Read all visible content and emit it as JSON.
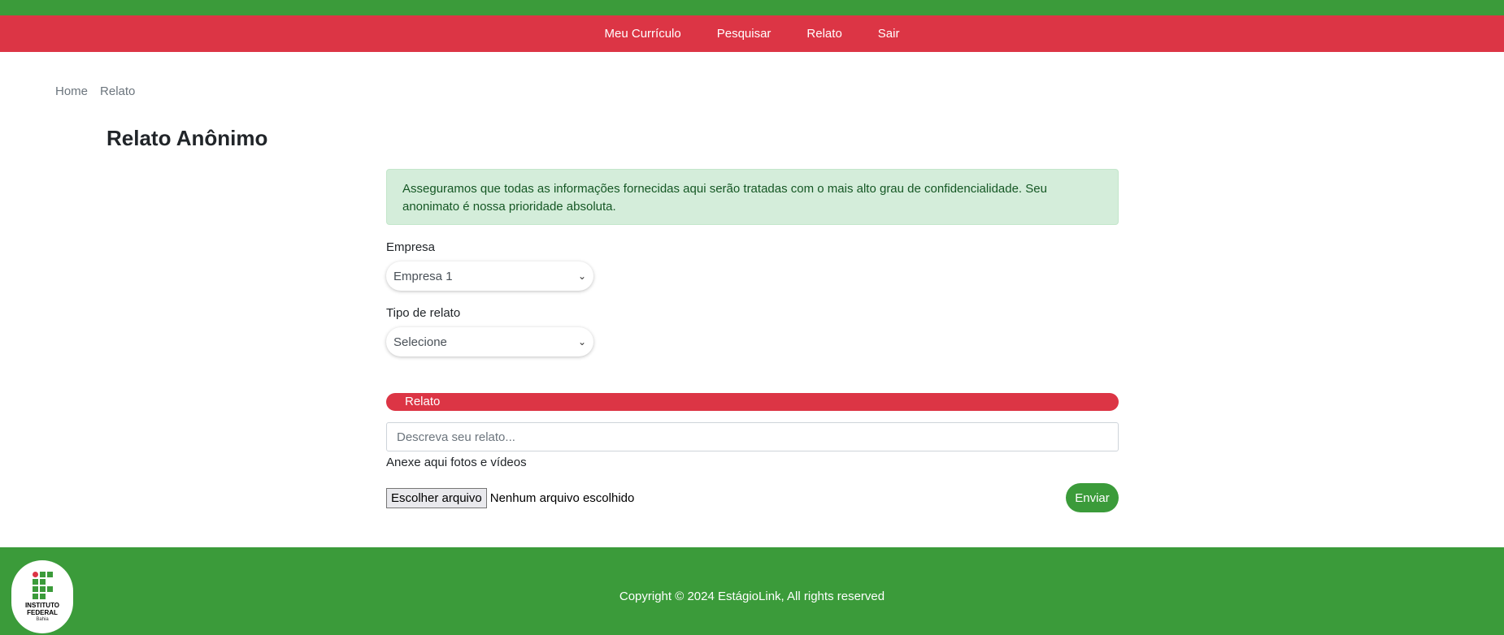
{
  "nav": {
    "items": [
      "Meu Currículo",
      "Pesquisar",
      "Relato",
      "Sair"
    ]
  },
  "breadcrumb": {
    "home": "Home",
    "current": "Relato"
  },
  "page": {
    "title": "Relato Anônimo"
  },
  "alert": {
    "text": "Asseguramos que todas as informações fornecidas aqui serão tratadas com o mais alto grau de confidencialidade. Seu anonimato é nossa prioridade absoluta."
  },
  "form": {
    "empresa_label": "Empresa",
    "empresa_value": "Empresa 1",
    "tipo_label": "Tipo de relato",
    "tipo_value": "Selecione",
    "relato_section": "Relato",
    "relato_placeholder": "Descreva seu relato...",
    "attach_label": "Anexe aqui fotos e vídeos",
    "file_button": "Escolher arquivo",
    "file_status": "Nenhum arquivo escolhido",
    "submit": "Enviar"
  },
  "footer": {
    "copyright": "Copyright © 2024 EstágioLink, All rights reserved",
    "logo_line1": "INSTITUTO",
    "logo_line2": "FEDERAL",
    "logo_line3": "Bahia"
  },
  "colors": {
    "green": "#3b9b3a",
    "red": "#dc3545",
    "alert_bg": "#d4edda"
  }
}
